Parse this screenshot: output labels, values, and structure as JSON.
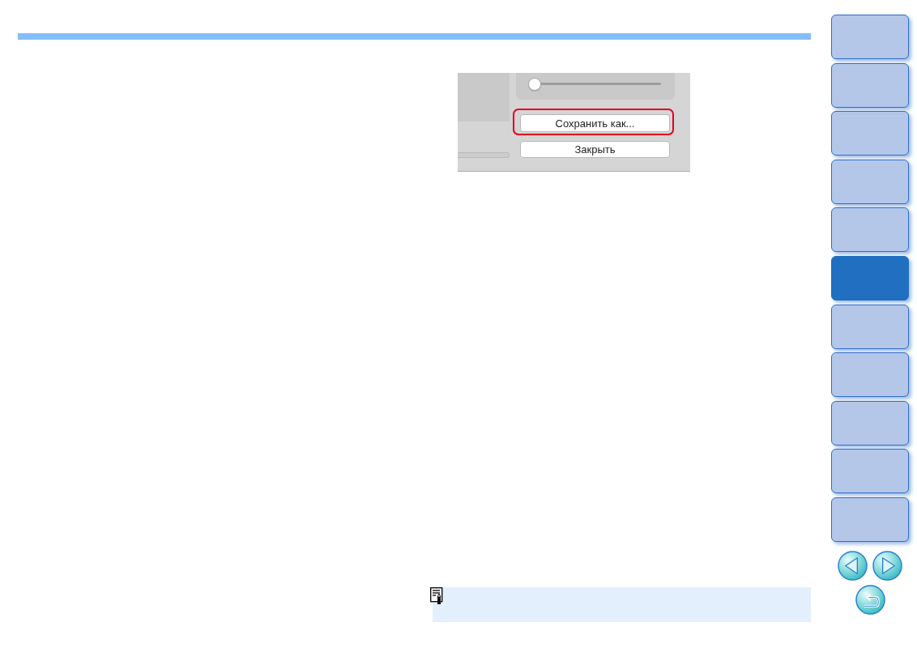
{
  "dialog_screenshot": {
    "slider": {
      "level": 0
    },
    "buttons": [
      {
        "label": "Сохранить как...",
        "highlighted": true
      },
      {
        "label": "Закрыть",
        "highlighted": false
      }
    ]
  },
  "side_tabs": [
    {
      "selected": false
    },
    {
      "selected": false
    },
    {
      "selected": false
    },
    {
      "selected": false
    },
    {
      "selected": false
    },
    {
      "selected": true
    },
    {
      "selected": false
    },
    {
      "selected": false
    },
    {
      "selected": false
    },
    {
      "selected": false
    },
    {
      "selected": false
    }
  ]
}
